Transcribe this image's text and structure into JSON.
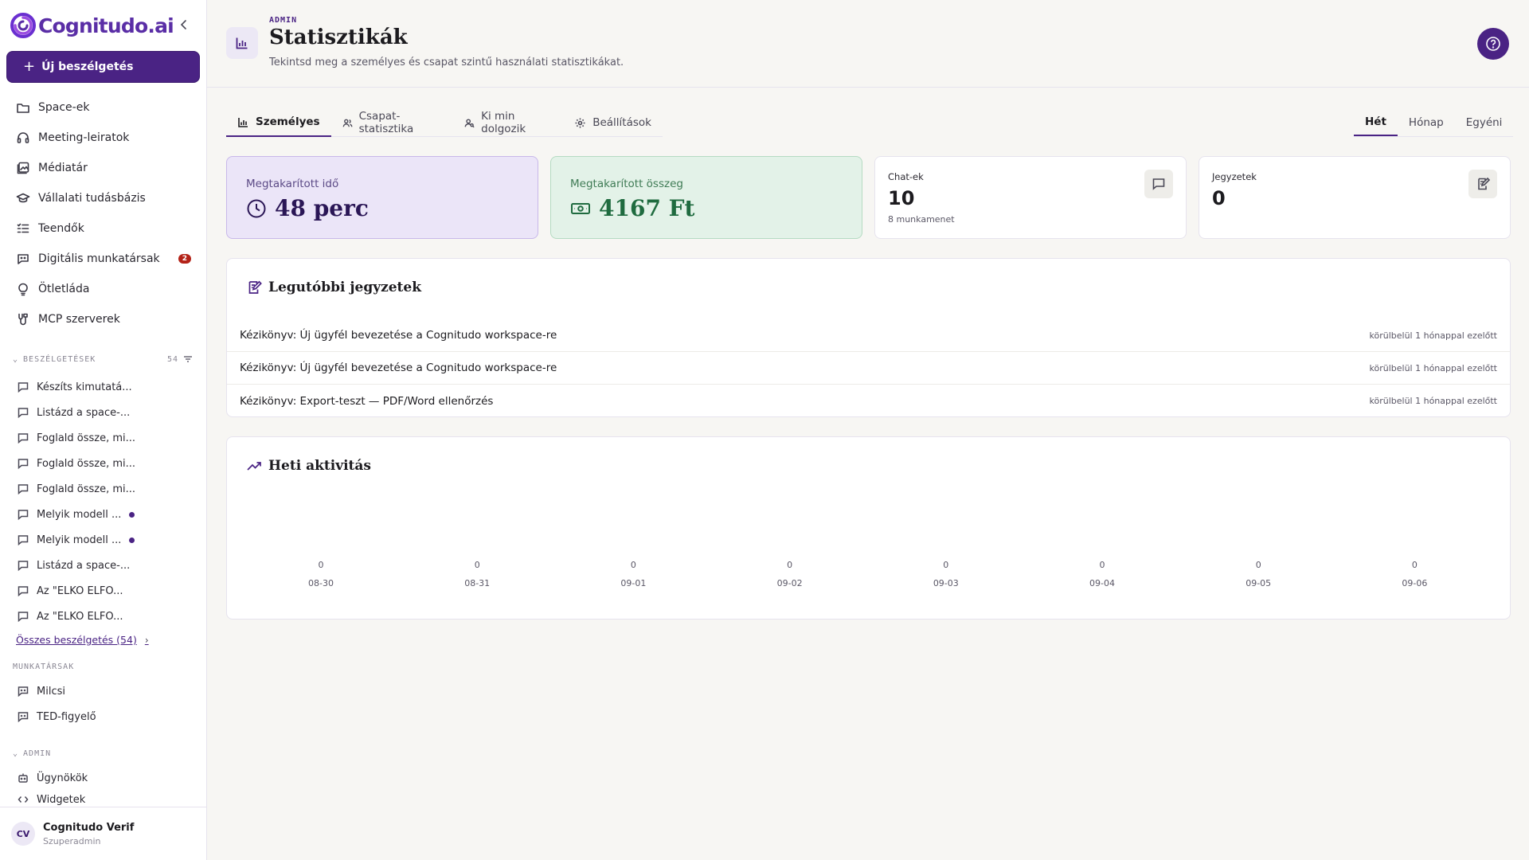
{
  "brand": {
    "name": "Cognitudo.ai"
  },
  "sidebar": {
    "new_chat_label": "Új beszélgetés",
    "nav": [
      {
        "label": "Space-ek",
        "icon": "folder-icon"
      },
      {
        "label": "Meeting-leiratok",
        "icon": "headset-icon"
      },
      {
        "label": "Médiatár",
        "icon": "media-icon"
      },
      {
        "label": "Vállalati tudásbázis",
        "icon": "graduation-cap-icon"
      },
      {
        "label": "Teendők",
        "icon": "checklist-icon"
      },
      {
        "label": "Digitális munkatársak",
        "icon": "bot-chat-icon",
        "badge": "2"
      },
      {
        "label": "Ötletláda",
        "icon": "lightbulb-icon"
      },
      {
        "label": "MCP szerverek",
        "icon": "server-plug-icon"
      }
    ],
    "conversations_header": "BESZÉLGETÉSEK",
    "conversations_count": "54",
    "conversations": [
      {
        "label": "Készíts kimutatá...",
        "unread": false
      },
      {
        "label": "Listázd a space-...",
        "unread": false
      },
      {
        "label": "Foglald össze, mi...",
        "unread": false
      },
      {
        "label": "Foglald össze, mi...",
        "unread": false
      },
      {
        "label": "Foglald össze, mi...",
        "unread": false
      },
      {
        "label": "Melyik modell ...",
        "unread": true
      },
      {
        "label": "Melyik modell ...",
        "unread": true
      },
      {
        "label": "Listázd a space-...",
        "unread": false
      },
      {
        "label": "Az \"ELKO ELFO...",
        "unread": false
      },
      {
        "label": "Az \"ELKO ELFO...",
        "unread": false
      }
    ],
    "all_conversations_label": "Összes beszélgetés (54)",
    "coworkers_header": "MUNKATÁRSAK",
    "coworkers": [
      {
        "label": "Milcsi"
      },
      {
        "label": "TED-figyelő"
      }
    ],
    "admin_header": "ADMIN",
    "admin_items": [
      {
        "label": "Ügynökök"
      },
      {
        "label": "Widgetek"
      }
    ],
    "user": {
      "initials": "CV",
      "name": "Cognitudo Verif",
      "role": "Szuperadmin"
    }
  },
  "header": {
    "tag": "ADMIN",
    "title": "Statisztikák",
    "subtitle": "Tekintsd meg a személyes és csapat szintű használati statisztikákat."
  },
  "tabs": [
    {
      "label": "Személyes",
      "icon": "bar-chart-icon",
      "active": true
    },
    {
      "label": "Csapat-statisztika",
      "icon": "users-icon",
      "active": false
    },
    {
      "label": "Ki min dolgozik",
      "icon": "user-search-icon",
      "active": false
    },
    {
      "label": "Beállítások",
      "icon": "gear-icon",
      "active": false
    }
  ],
  "period": [
    {
      "label": "Hét",
      "active": true
    },
    {
      "label": "Hónap",
      "active": false
    },
    {
      "label": "Egyéni",
      "active": false
    }
  ],
  "cards": {
    "saved_time": {
      "label": "Megtakarított idő",
      "value": "48 perc"
    },
    "saved_money": {
      "label": "Megtakarított összeg",
      "value": "4167 Ft"
    },
    "chats": {
      "label": "Chat-ek",
      "value": "10",
      "sub": "8 munkamenet"
    },
    "notes": {
      "label": "Jegyzetek",
      "value": "0"
    }
  },
  "recent_notes": {
    "title": "Legutóbbi jegyzetek",
    "items": [
      {
        "title": "Kézikönyv: Új ügyfél bevezetése a Cognitudo workspace-re",
        "time": "körülbelül 1 hónappal ezelőtt"
      },
      {
        "title": "Kézikönyv: Új ügyfél bevezetése a Cognitudo workspace-re",
        "time": "körülbelül 1 hónappal ezelőtt"
      },
      {
        "title": "Kézikönyv: Export-teszt — PDF/Word ellenőrzés",
        "time": "körülbelül 1 hónappal ezelőtt"
      }
    ]
  },
  "activity": {
    "title": "Heti aktivitás"
  },
  "chart_data": {
    "type": "bar",
    "categories": [
      "08-30",
      "08-31",
      "09-01",
      "09-02",
      "09-03",
      "09-04",
      "09-05",
      "09-06"
    ],
    "values": [
      0,
      0,
      0,
      0,
      0,
      0,
      0,
      0
    ],
    "title": "Heti aktivitás",
    "xlabel": "",
    "ylabel": ""
  }
}
